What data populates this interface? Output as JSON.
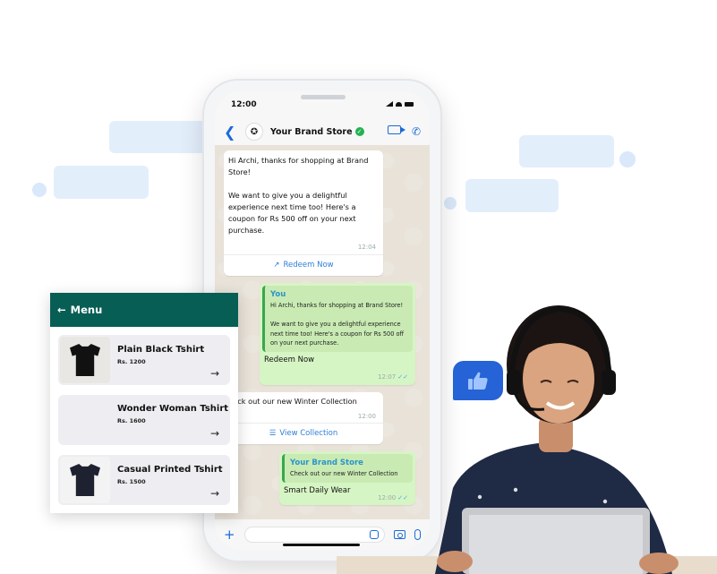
{
  "phone": {
    "status_time": "12:00",
    "contact_name": "Your Brand Store",
    "messages": {
      "m1_text": "Hi Archi, thanks for shopping at Brand Store!\n\nWe want to give you a delightful experience next time too! Here's a coupon for Rs 500 off on your next purchase.",
      "m1_time": "12:04",
      "m1_button": "Redeem Now",
      "m2_quote_name": "You",
      "m2_quote_text": "Hi Archi, thanks for shopping at Brand Store!\n\nWe want to give you a delightful experience next time too! Here's a coupon for Rs 500 off on your next purchase.",
      "m2_text": "Redeem Now",
      "m2_time": "12:07",
      "m3_text": "heck out our new Winter Collection",
      "m3_time": "12:00",
      "m3_button": "View Collection",
      "m4_quote_name": "Your Brand Store",
      "m4_quote_text": "Check out our new Winter Collection",
      "m4_text": "Smart Daily Wear",
      "m4_time": "12:00"
    }
  },
  "menu": {
    "title": "Menu",
    "items": [
      {
        "name": "Plain Black Tshirt",
        "price": "Rs. 1200"
      },
      {
        "name": "Wonder Woman Tshirt",
        "price": "Rs. 1600"
      },
      {
        "name": "Casual Printed Tshirt",
        "price": "Rs. 1500"
      }
    ]
  },
  "colors": {
    "menu_header": "#075e54",
    "link_blue": "#2d7fd6",
    "outgoing_bubble": "#d6f5c4",
    "thumb_bubble": "#2563d6"
  }
}
